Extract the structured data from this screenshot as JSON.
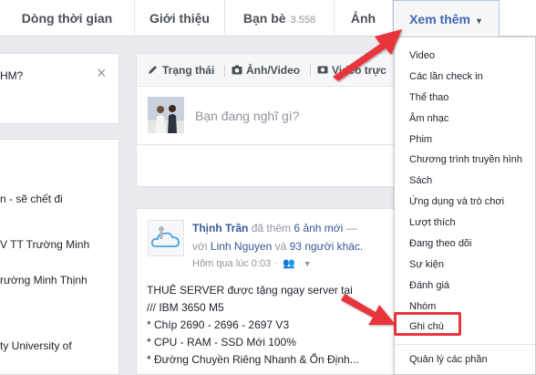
{
  "tabs": {
    "timeline": "Dòng thời gian",
    "about": "Giới thiệu",
    "friends": "Bạn bè",
    "friends_count": "3.558",
    "photos": "Ảnh",
    "more": "Xem thêm"
  },
  "left": {
    "top_text": "HM?",
    "close": "×",
    "items": [
      "n - sẽ chết đi",
      "V TT Trường Minh",
      "rường Minh Thịnh",
      "ty University of"
    ]
  },
  "composer": {
    "status": "Trạng thái",
    "photo_video": "Ảnh/Video",
    "live_video": "Video trực",
    "placeholder": "Bạn đang nghĩ gì?"
  },
  "post": {
    "author": "Thịnh Trần",
    "action": "đã thêm",
    "photos_link": "6 ảnh mới",
    "dash": "—",
    "with": "với",
    "tagged": "Linh Nguyen",
    "and": "và",
    "others": "93 người khác.",
    "time": "Hôm qua lúc 0:03 ·",
    "lines": [
      "THUÊ SERVER được tặng ngay server tại",
      "/// IBM 3650 M5",
      "* Chíp 2690 - 2696 - 2697 V3",
      "* CPU - RAM - SSD Mới 100%",
      "* Đường Chuyền Riêng Nhanh & Ổn Định..."
    ]
  },
  "more_menu": {
    "items": [
      "Video",
      "Các lần check in",
      "Thể thao",
      "Âm nhạc",
      "Phim",
      "Chương trình truyền hình",
      "Sách",
      "Ứng dụng và trò chơi",
      "Lượt thích",
      "Đang theo dõi",
      "Sự kiện",
      "Đánh giá",
      "Nhóm",
      "Ghi chú"
    ],
    "manage": "Quản lý các phần"
  },
  "colors": {
    "link": "#365899",
    "highlight": "#e8363b",
    "active_tab": "#4267b2"
  }
}
